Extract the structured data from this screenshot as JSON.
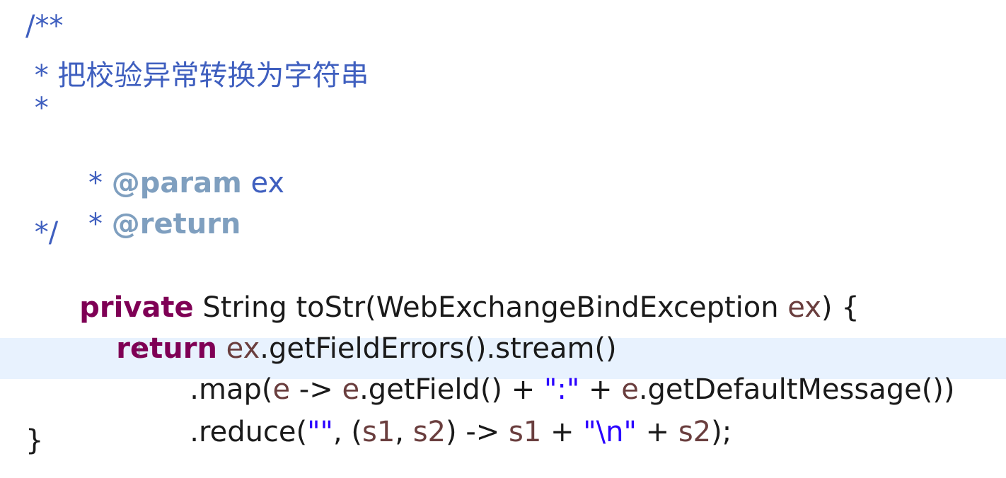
{
  "colors": {
    "background": "#ffffff",
    "comment": "#3f5fbf",
    "doc_tag": "#7f9fbf",
    "keyword": "#7f0055",
    "string": "#2a00ff",
    "variable": "#6a3e3e",
    "current_line_highlight": "#e8f2fe"
  },
  "code": {
    "l1": "/**",
    "l2": " * 把校验异常转换为字符串",
    "l3": " *",
    "l4_star": " * ",
    "l4_tag": "@param",
    "l4_rest": " ex",
    "l5_star": " * ",
    "l5_tag": "@return",
    "l6": " */",
    "l7": {
      "kw": "private",
      "t1": " String toStr(WebExchangeBindException ",
      "param": "ex",
      "t2": ") {"
    },
    "l8": {
      "kw": "return",
      "sp": " ",
      "param": "ex",
      "t1": ".getFieldErrors().stream()"
    },
    "l9": {
      "t1": ".map(",
      "p1": "e",
      "t2": " -> ",
      "p2": "e",
      "t3": ".getField() + ",
      "s1": "\":\"",
      "t4": " + ",
      "p3": "e",
      "t5": ".getDefaultMessage())"
    },
    "l10": {
      "t1": ".reduce(",
      "s1": "\"\"",
      "t2": ", (",
      "p1": "s1",
      "t3": ", ",
      "p2": "s2",
      "t4": ") -> ",
      "p3": "s1",
      "t5": " + ",
      "s2": "\"\\n\"",
      "t6": " + ",
      "p4": "s2",
      "t7": ");"
    },
    "l11": "}"
  }
}
